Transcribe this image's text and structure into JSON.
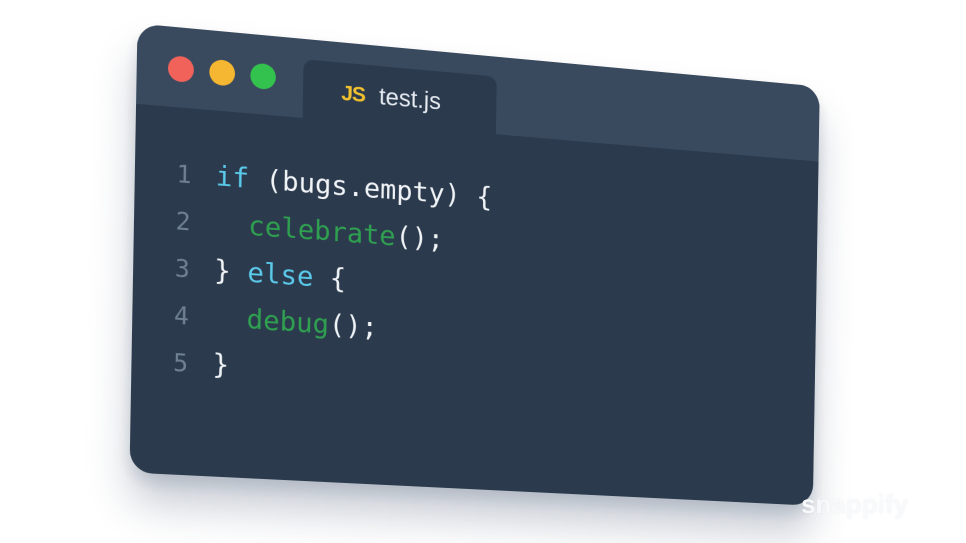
{
  "window": {
    "tab": {
      "icon_text": "JS",
      "filename": "test.js"
    }
  },
  "code": {
    "lines": [
      {
        "number": "1",
        "tokens": [
          "if",
          " (bugs.empty) {"
        ]
      },
      {
        "number": "2",
        "tokens": [
          "  ",
          "celebrate",
          "();"
        ]
      },
      {
        "number": "3",
        "tokens": [
          "} ",
          "else",
          " {"
        ]
      },
      {
        "number": "4",
        "tokens": [
          "  ",
          "debug",
          "();"
        ]
      },
      {
        "number": "5",
        "tokens": [
          "}"
        ]
      }
    ]
  },
  "watermark": "snappify",
  "colors": {
    "keyword": "#5bc9ea",
    "function": "#2fa050",
    "plain": "#f1f4f7",
    "background": "#2b3a4d",
    "titlebar": "#3a4a5e"
  }
}
